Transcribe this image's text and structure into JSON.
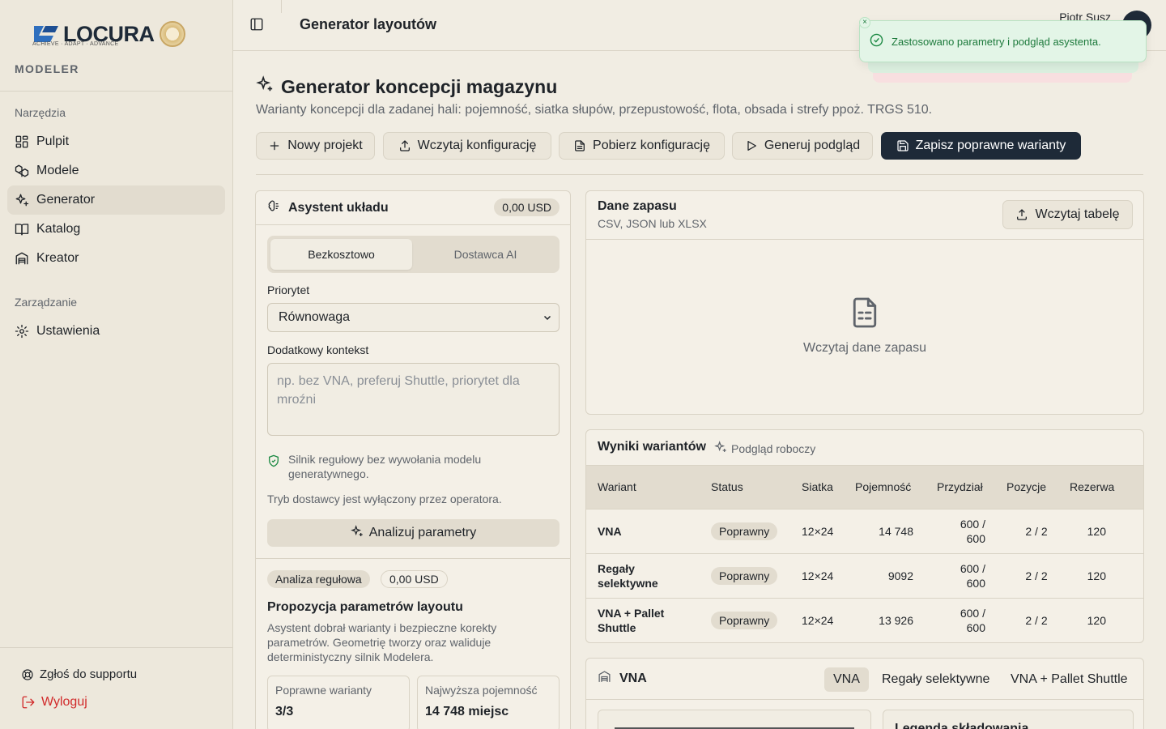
{
  "sidebar": {
    "logo_text": "LOCURA",
    "logo_tagline": "ACHIEVE · ADAPT · ADVANCE",
    "brand": "MODELER",
    "section_tools": "Narzędzia",
    "items": [
      {
        "label": "Pulpit",
        "icon": "grid-icon"
      },
      {
        "label": "Modele",
        "icon": "boxes-icon"
      },
      {
        "label": "Generator",
        "icon": "sparkles-icon"
      },
      {
        "label": "Katalog",
        "icon": "book-icon"
      },
      {
        "label": "Kreator",
        "icon": "warehouse-icon"
      }
    ],
    "section_admin": "Zarządzanie",
    "settings_label": "Ustawienia",
    "support_label": "Zgłoś do supportu",
    "logout_label": "Wyloguj"
  },
  "header": {
    "title": "Generator layoutów",
    "user_name": "Piotr Susz"
  },
  "toast": {
    "message": "Zastosowano parametry i podgląd asystenta.",
    "close": "×"
  },
  "page": {
    "title": "Generator koncepcji magazynu",
    "subtitle": "Warianty koncepcji dla zadanej hali: pojemność, siatka słupów, przepustowość, flota, obsada i strefy ppoż. TRGS 510."
  },
  "toolbar": {
    "new_project": "Nowy projekt",
    "load_config": "Wczytaj konfigurację",
    "download_config": "Pobierz konfigurację",
    "generate_preview": "Generuj podgląd",
    "save_variants": "Zapisz poprawne warianty"
  },
  "assistant": {
    "title": "Asystent układu",
    "cost": "0,00 USD",
    "mode_free": "Bezkosztowo",
    "mode_ai": "Dostawca AI",
    "priority_label": "Priorytet",
    "priority_value": "Równowaga",
    "context_label": "Dodatkowy kontekst",
    "context_placeholder": "np. bez VNA, preferuj Shuttle, priorytet dla mroźni",
    "rule_note": "Silnik regułowy bez wywołania modelu generatywnego.",
    "provider_note": "Tryb dostawcy jest wyłączony przez operatora.",
    "analyze_button": "Analizuj parametry",
    "analysis_badge": "Analiza regułowa",
    "analysis_cost": "0,00 USD",
    "proposal_title": "Propozycja parametrów layoutu",
    "proposal_desc": "Asystent dobrał warianty i bezpieczne korekty parametrów. Geometrię tworzy oraz waliduje deterministyczny silnik Modelera.",
    "stats": [
      {
        "label": "Poprawne warianty",
        "value": "3/3"
      },
      {
        "label": "Najwyższa pojemność",
        "value": "14 748 miejsc"
      }
    ]
  },
  "stock": {
    "title": "Dane zapasu",
    "subtitle": "CSV, JSON lub XLSX",
    "load_button": "Wczytaj tabelę",
    "empty_text": "Wczytaj dane zapasu"
  },
  "results": {
    "title": "Wyniki wariantów",
    "draft_label": "Podgląd roboczy",
    "columns": [
      "Wariant",
      "Status",
      "Siatka",
      "Pojemność",
      "Przydział",
      "Pozycje",
      "Rezerwa"
    ],
    "rows": [
      {
        "variant": "VNA",
        "status": "Poprawny",
        "grid": "12×24",
        "capacity": "14 748",
        "allocation": "600 / 600",
        "positions": "2 / 2",
        "reserve": "120"
      },
      {
        "variant": "Regały selektywne",
        "status": "Poprawny",
        "grid": "12×24",
        "capacity": "9092",
        "allocation": "600 / 600",
        "positions": "2 / 2",
        "reserve": "120"
      },
      {
        "variant": "VNA + Pallet Shuttle",
        "status": "Poprawny",
        "grid": "12×24",
        "capacity": "13 926",
        "allocation": "600 / 600",
        "positions": "2 / 2",
        "reserve": "120"
      }
    ]
  },
  "variant_panel": {
    "title": "VNA",
    "tabs": [
      "VNA",
      "Regały selektywne",
      "VNA + Pallet Shuttle"
    ],
    "legend_title": "Legenda składowania"
  }
}
